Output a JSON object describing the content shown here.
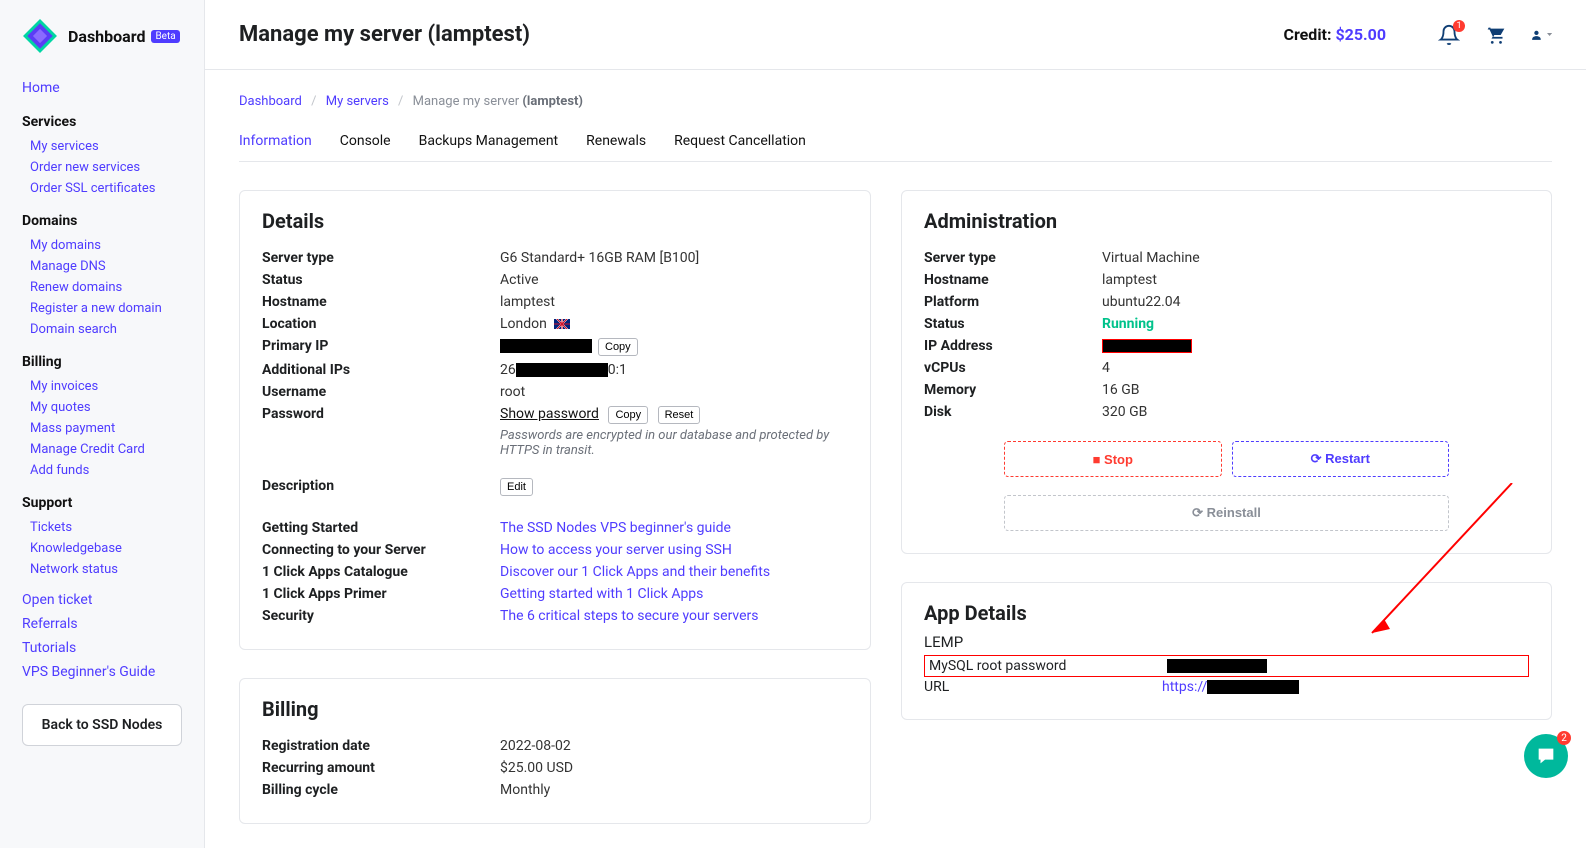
{
  "brand": {
    "name": "Dashboard",
    "badge": "Beta"
  },
  "sidebar": {
    "home": "Home",
    "services": {
      "head": "Services",
      "items": [
        "My services",
        "Order new services",
        "Order SSL certificates"
      ]
    },
    "domains": {
      "head": "Domains",
      "items": [
        "My domains",
        "Manage DNS",
        "Renew domains",
        "Register a new domain",
        "Domain search"
      ]
    },
    "billing": {
      "head": "Billing",
      "items": [
        "My invoices",
        "My quotes",
        "Mass payment",
        "Manage Credit Card",
        "Add funds"
      ]
    },
    "support": {
      "head": "Support",
      "items": [
        "Tickets",
        "Knowledgebase",
        "Network status"
      ]
    },
    "links": [
      "Open ticket",
      "Referrals",
      "Tutorials",
      "VPS Beginner's Guide"
    ],
    "back": "Back to SSD Nodes"
  },
  "topbar": {
    "title": "Manage my server (lamptest)",
    "credit_label": "Credit: ",
    "credit_value": "$25.00",
    "bell_count": "1"
  },
  "breadcrumb": {
    "a": "Dashboard",
    "b": "My servers",
    "c": "Manage my server",
    "d": "(lamptest)"
  },
  "tabs": [
    "Information",
    "Console",
    "Backups Management",
    "Renewals",
    "Request Cancellation"
  ],
  "details": {
    "title": "Details",
    "server_type": {
      "k": "Server type",
      "v": "G6 Standard+ 16GB RAM [B100]"
    },
    "status": {
      "k": "Status",
      "v": "Active"
    },
    "hostname": {
      "k": "Hostname",
      "v": "lamptest"
    },
    "location": {
      "k": "Location",
      "v": "London "
    },
    "primary_ip": {
      "k": "Primary IP",
      "copy": "Copy"
    },
    "additional": {
      "k": "Additional IPs",
      "pre": "26",
      "suf": "0:1"
    },
    "username": {
      "k": "Username",
      "v": "root"
    },
    "password": {
      "k": "Password",
      "show": "Show password",
      "copy": "Copy",
      "reset": "Reset",
      "note": "Passwords are encrypted in our database and protected by HTTPS in transit."
    },
    "description": {
      "k": "Description",
      "edit": "Edit"
    },
    "links": {
      "getting_started": {
        "k": "Getting Started",
        "v": "The SSD Nodes VPS beginner's guide"
      },
      "connect": {
        "k": "Connecting to your Server",
        "v": "How to access your server using SSH"
      },
      "catalogue": {
        "k": "1 Click Apps Catalogue",
        "v": "Discover our 1 Click Apps and their benefits"
      },
      "primer": {
        "k": "1 Click Apps Primer",
        "v": "Getting started with 1 Click Apps"
      },
      "security": {
        "k": "Security",
        "v": "The 6 critical steps to secure your servers"
      }
    }
  },
  "admin": {
    "title": "Administration",
    "server_type": {
      "k": "Server type",
      "v": "Virtual Machine"
    },
    "hostname": {
      "k": "Hostname",
      "v": "lamptest"
    },
    "platform": {
      "k": "Platform",
      "v": "ubuntu22.04"
    },
    "status": {
      "k": "Status",
      "v": "Running"
    },
    "ip": {
      "k": "IP Address"
    },
    "vcpus": {
      "k": "vCPUs",
      "v": "4"
    },
    "memory": {
      "k": "Memory",
      "v": "16 GB"
    },
    "disk": {
      "k": "Disk",
      "v": "320 GB"
    },
    "stop": "Stop",
    "restart": "Restart",
    "reinstall": "Reinstall"
  },
  "app": {
    "title": "App Details",
    "name": "LEMP",
    "mysql_k": "MySQL root password",
    "url_k": "URL",
    "url_pre": "https://"
  },
  "billing_card": {
    "title": "Billing",
    "reg": {
      "k": "Registration date",
      "v": "2022-08-02"
    },
    "amt": {
      "k": "Recurring amount",
      "v": "$25.00 USD"
    },
    "cycle": {
      "k": "Billing cycle",
      "v": "Monthly"
    }
  },
  "chat_badge": "2"
}
